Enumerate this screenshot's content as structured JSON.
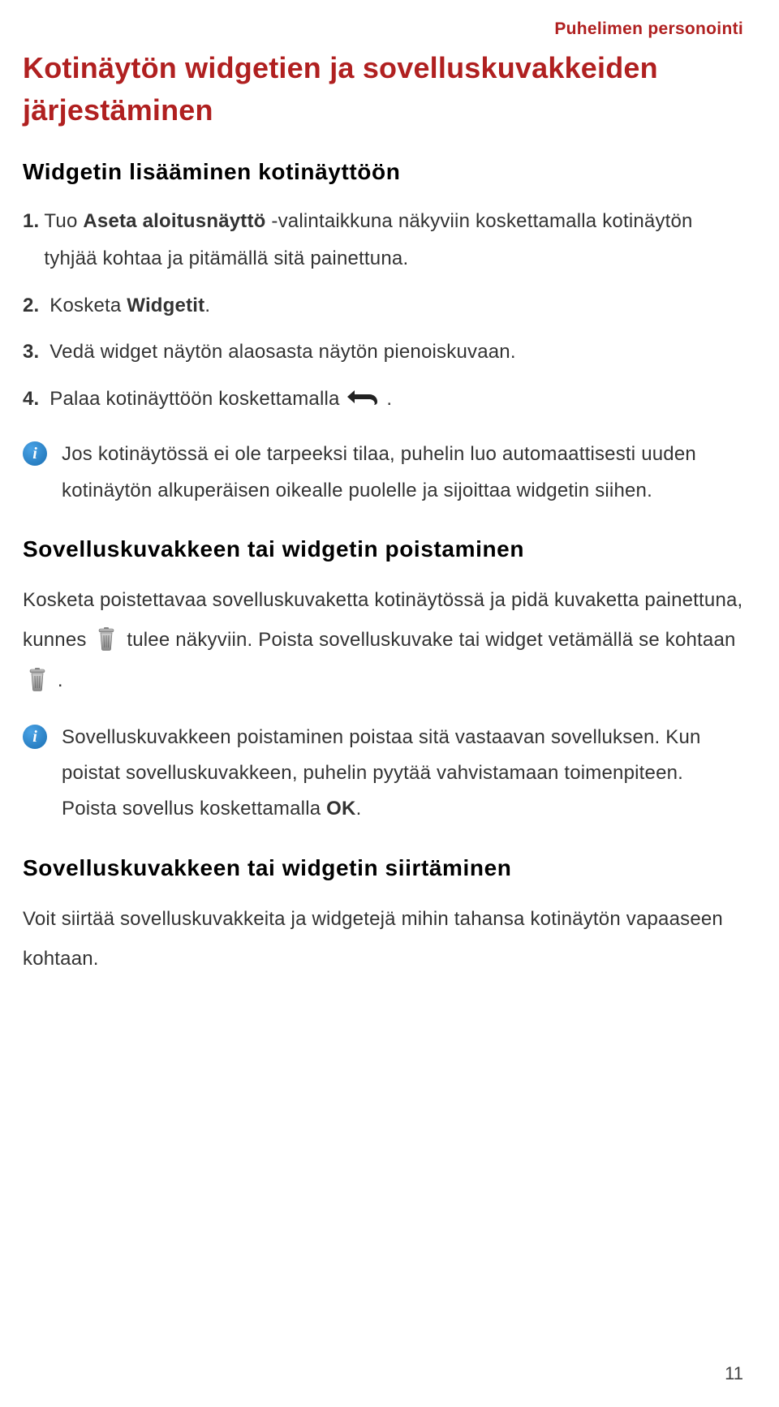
{
  "header": {
    "section": "Puhelimen personointi"
  },
  "title": "Kotinäytön widgetien ja sovelluskuvakkeiden järjestäminen",
  "sec1": {
    "heading": "Widgetin lisääminen kotinäyttöön",
    "steps": {
      "n1": "1.",
      "t1a": "Tuo ",
      "t1b": "Aseta aloitusnäyttö",
      "t1c": " -valintaikkuna näkyviin koskettamalla kotinäytön tyhjää kohtaa ja pitämällä sitä painettuna.",
      "n2": "2.",
      "t2a": "Kosketa ",
      "t2b": "Widgetit",
      "t2c": ".",
      "n3": "3.",
      "t3": "Vedä widget näytön alaosasta näytön pienoiskuvaan.",
      "n4": "4.",
      "t4a": "Palaa kotinäyttöön koskettamalla ",
      "t4b": "."
    },
    "info": "Jos kotinäytössä ei ole tarpeeksi tilaa, puhelin luo automaattisesti uuden kotinäytön alkuperäisen oikealle puolelle ja sijoittaa widgetin siihen."
  },
  "sec2": {
    "heading": "Sovelluskuvakkeen tai widgetin poistaminen",
    "p_a": "Kosketa poistettavaa sovelluskuvaketta kotinäytössä ja pidä kuvaketta painettuna, kunnes ",
    "p_b": " tulee näkyviin. Poista sovelluskuvake tai widget vetämällä se kohtaan ",
    "p_c": ".",
    "info_a": "Sovelluskuvakkeen poistaminen poistaa sitä vastaavan sovelluksen. Kun poistat sovelluskuvakkeen, puhelin pyytää vahvistamaan toimenpiteen. Poista sovellus koskettamalla ",
    "info_b": "OK",
    "info_c": "."
  },
  "sec3": {
    "heading": "Sovelluskuvakkeen tai widgetin siirtäminen",
    "p": "Voit siirtää sovelluskuvakkeita ja widgetejä mihin tahansa kotinäytön vapaaseen kohtaan."
  },
  "page_number": "11",
  "icons": {
    "info": "i",
    "back": "back-icon",
    "trash": "trash-icon"
  }
}
